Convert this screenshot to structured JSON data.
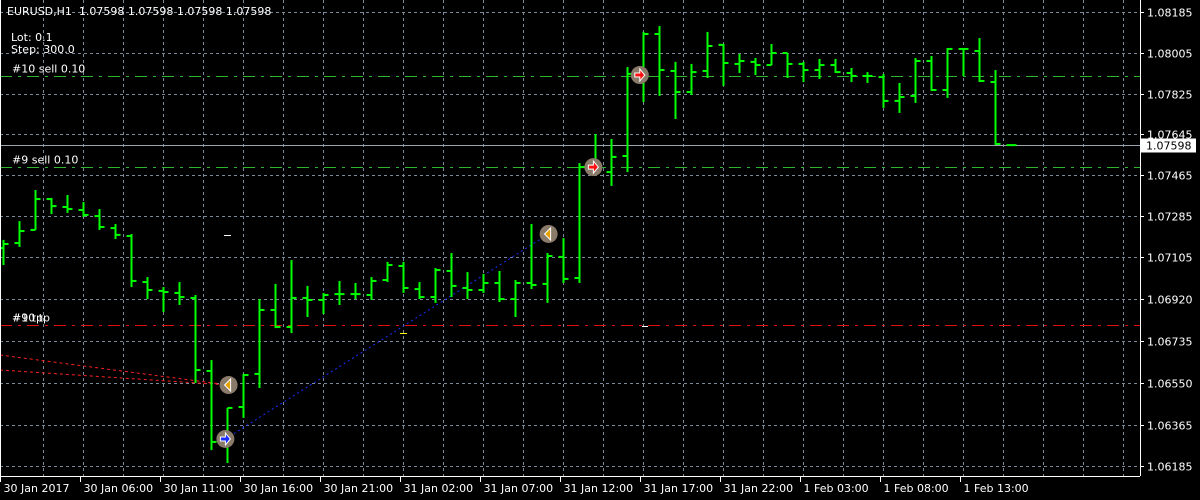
{
  "header": {
    "symbol_line": "EURUSD,H1  1.07598 1.07598 1.07598 1.07598",
    "lot": "Lot: 0.1",
    "step": "Step: 300.0"
  },
  "colors": {
    "background": "#000000",
    "bar": "#00ff00",
    "grid": "#7b8a9a",
    "sell_line": "#2db52d",
    "tp_line": "#e01010",
    "bid_line": "#9aa4b0",
    "sell_path": "#ff2020",
    "buy_path": "#1a2cff"
  },
  "chart_data": {
    "type": "ohlc",
    "symbol": "EURUSD",
    "timeframe": "H1",
    "ylim": [
      1.06185,
      1.08185
    ],
    "y_ticks": [
      "1.08185",
      "1.08005",
      "1.07825",
      "1.07645",
      "1.07465",
      "1.07285",
      "1.07105",
      "1.06920",
      "1.06735",
      "1.06550",
      "1.06365",
      "1.06185"
    ],
    "x_labels": [
      {
        "bar": 0,
        "label": "30 Jan 2017"
      },
      {
        "bar": 5,
        "label": "30 Jan 06:00"
      },
      {
        "bar": 10,
        "label": "30 Jan 11:00"
      },
      {
        "bar": 15,
        "label": "30 Jan 16:00"
      },
      {
        "bar": 20,
        "label": "30 Jan 21:00"
      },
      {
        "bar": 25,
        "label": "31 Jan 02:00"
      },
      {
        "bar": 30,
        "label": "31 Jan 07:00"
      },
      {
        "bar": 35,
        "label": "31 Jan 12:00"
      },
      {
        "bar": 40,
        "label": "31 Jan 17:00"
      },
      {
        "bar": 45,
        "label": "31 Jan 22:00"
      },
      {
        "bar": 50,
        "label": "1 Feb 03:00"
      },
      {
        "bar": 55,
        "label": "1 Feb 08:00"
      },
      {
        "bar": 60,
        "label": "1 Feb 13:00"
      }
    ],
    "bars_ohlc": [
      [
        1.07144,
        1.0718,
        1.07069,
        1.07162
      ],
      [
        1.07166,
        1.07263,
        1.07149,
        1.07219
      ],
      [
        1.07224,
        1.074,
        1.07224,
        1.0736
      ],
      [
        1.0736,
        1.07365,
        1.07294,
        1.07329
      ],
      [
        1.07325,
        1.07378,
        1.07299,
        1.07316
      ],
      [
        1.07312,
        1.07347,
        1.07281,
        1.0729
      ],
      [
        1.07285,
        1.07316,
        1.07224,
        1.07237
      ],
      [
        1.07232,
        1.0725,
        1.07184,
        1.07202
      ],
      [
        1.07197,
        1.07206,
        1.06972,
        1.06999
      ],
      [
        1.06994,
        1.07016,
        1.06919,
        1.06959
      ],
      [
        1.06955,
        1.06972,
        1.06862,
        1.0695
      ],
      [
        1.06946,
        1.06994,
        1.06893,
        1.06928
      ],
      [
        1.06924,
        1.06937,
        1.06549,
        1.06606
      ],
      [
        1.06602,
        1.0665,
        1.06253,
        1.06289
      ],
      [
        1.06298,
        1.06439,
        1.06196,
        1.06439
      ],
      [
        1.06443,
        1.06589,
        1.06395,
        1.06584
      ],
      [
        1.06589,
        1.06919,
        1.06527,
        1.06871
      ],
      [
        1.06871,
        1.06986,
        1.06791,
        1.06796
      ],
      [
        1.06796,
        1.07091,
        1.06769,
        1.06924
      ],
      [
        1.06924,
        1.06977,
        1.0684,
        1.06915
      ],
      [
        1.06915,
        1.06946,
        1.06853,
        1.06937
      ],
      [
        1.06941,
        1.06999,
        1.06893,
        1.06941
      ],
      [
        1.06941,
        1.0699,
        1.06919,
        1.06941
      ],
      [
        1.06937,
        1.07016,
        1.06915,
        1.06999
      ],
      [
        1.07003,
        1.07083,
        1.06994,
        1.07069
      ],
      [
        1.07065,
        1.07083,
        1.06946,
        1.06968
      ],
      [
        1.06963,
        1.06994,
        1.06919,
        1.06928
      ],
      [
        1.06928,
        1.07056,
        1.06902,
        1.07047
      ],
      [
        1.07043,
        1.07122,
        1.06928,
        1.06977
      ],
      [
        1.06968,
        1.07038,
        1.06919,
        1.06959
      ],
      [
        1.06959,
        1.0703,
        1.06946,
        1.0699
      ],
      [
        1.0699,
        1.07043,
        1.06906,
        1.06919
      ],
      [
        1.06919,
        1.07003,
        1.0684,
        1.0699
      ],
      [
        1.0699,
        1.0725,
        1.06963,
        1.06981
      ],
      [
        1.06986,
        1.07122,
        1.06902,
        1.07109
      ],
      [
        1.07105,
        1.07188,
        1.0699,
        1.07008
      ],
      [
        1.07012,
        1.07519,
        1.0699,
        1.07501
      ],
      [
        1.07501,
        1.07647,
        1.07475,
        1.07479
      ],
      [
        1.07479,
        1.07625,
        1.07418,
        1.07546
      ],
      [
        1.0755,
        1.07942,
        1.07479,
        1.07912
      ],
      [
        1.07907,
        1.08097,
        1.07788,
        1.08088
      ],
      [
        1.08088,
        1.08123,
        1.07815,
        1.07929
      ],
      [
        1.07925,
        1.07965,
        1.07713,
        1.07832
      ],
      [
        1.07832,
        1.07956,
        1.07819,
        1.0792
      ],
      [
        1.07925,
        1.08097,
        1.07894,
        1.08035
      ],
      [
        1.0804,
        1.08044,
        1.07859,
        1.0796
      ],
      [
        1.07956,
        1.08,
        1.07916,
        1.07969
      ],
      [
        1.07965,
        1.07982,
        1.07907,
        1.07951
      ],
      [
        1.07951,
        1.08044,
        1.07951,
        1.08004
      ],
      [
        1.08004,
        1.08004,
        1.07894,
        1.07956
      ],
      [
        1.07956,
        1.07965,
        1.07876,
        1.07929
      ],
      [
        1.07929,
        1.07978,
        1.0789,
        1.07951
      ],
      [
        1.07951,
        1.07978,
        1.07916,
        1.0792
      ],
      [
        1.07916,
        1.07938,
        1.07876,
        1.07903
      ],
      [
        1.07903,
        1.0792,
        1.07872,
        1.07903
      ],
      [
        1.07898,
        1.07912,
        1.07762,
        1.07793
      ],
      [
        1.07793,
        1.07872,
        1.0774,
        1.0781
      ],
      [
        1.07815,
        1.07982,
        1.07784,
        1.07969
      ],
      [
        1.07969,
        1.07991,
        1.07837,
        1.07841
      ],
      [
        1.07841,
        1.08026,
        1.07806,
        1.08022
      ],
      [
        1.08022,
        1.08022,
        1.07903,
        1.08022
      ],
      [
        1.08013,
        1.0807,
        1.07876,
        1.07881
      ],
      [
        1.07876,
        1.07929,
        1.07599,
        1.07603
      ],
      [
        1.07598,
        1.07598,
        1.07598,
        1.07598
      ]
    ],
    "bid": "1.07598",
    "order_lines": [
      {
        "label": "#10 sell 0.10",
        "price": 1.07903,
        "kind": "sell"
      },
      {
        "label": "#9 sell 0.10",
        "price": 1.07501,
        "kind": "sell"
      },
      {
        "label": "#9 tp",
        "price": 1.06805,
        "kind": "tp"
      },
      {
        "label": "#10 tp",
        "price": 1.06805,
        "kind": "tp"
      }
    ],
    "trade_arrows": [
      {
        "bar": 14.1,
        "price": 1.0654,
        "kind": "close-sell"
      },
      {
        "bar": 13.9,
        "price": 1.06302,
        "kind": "buy"
      },
      {
        "bar": 34.1,
        "price": 1.07206,
        "kind": "close-sell"
      },
      {
        "bar": 36.9,
        "price": 1.07501,
        "kind": "sell"
      },
      {
        "bar": 39.8,
        "price": 1.07907,
        "kind": "sell"
      }
    ]
  }
}
